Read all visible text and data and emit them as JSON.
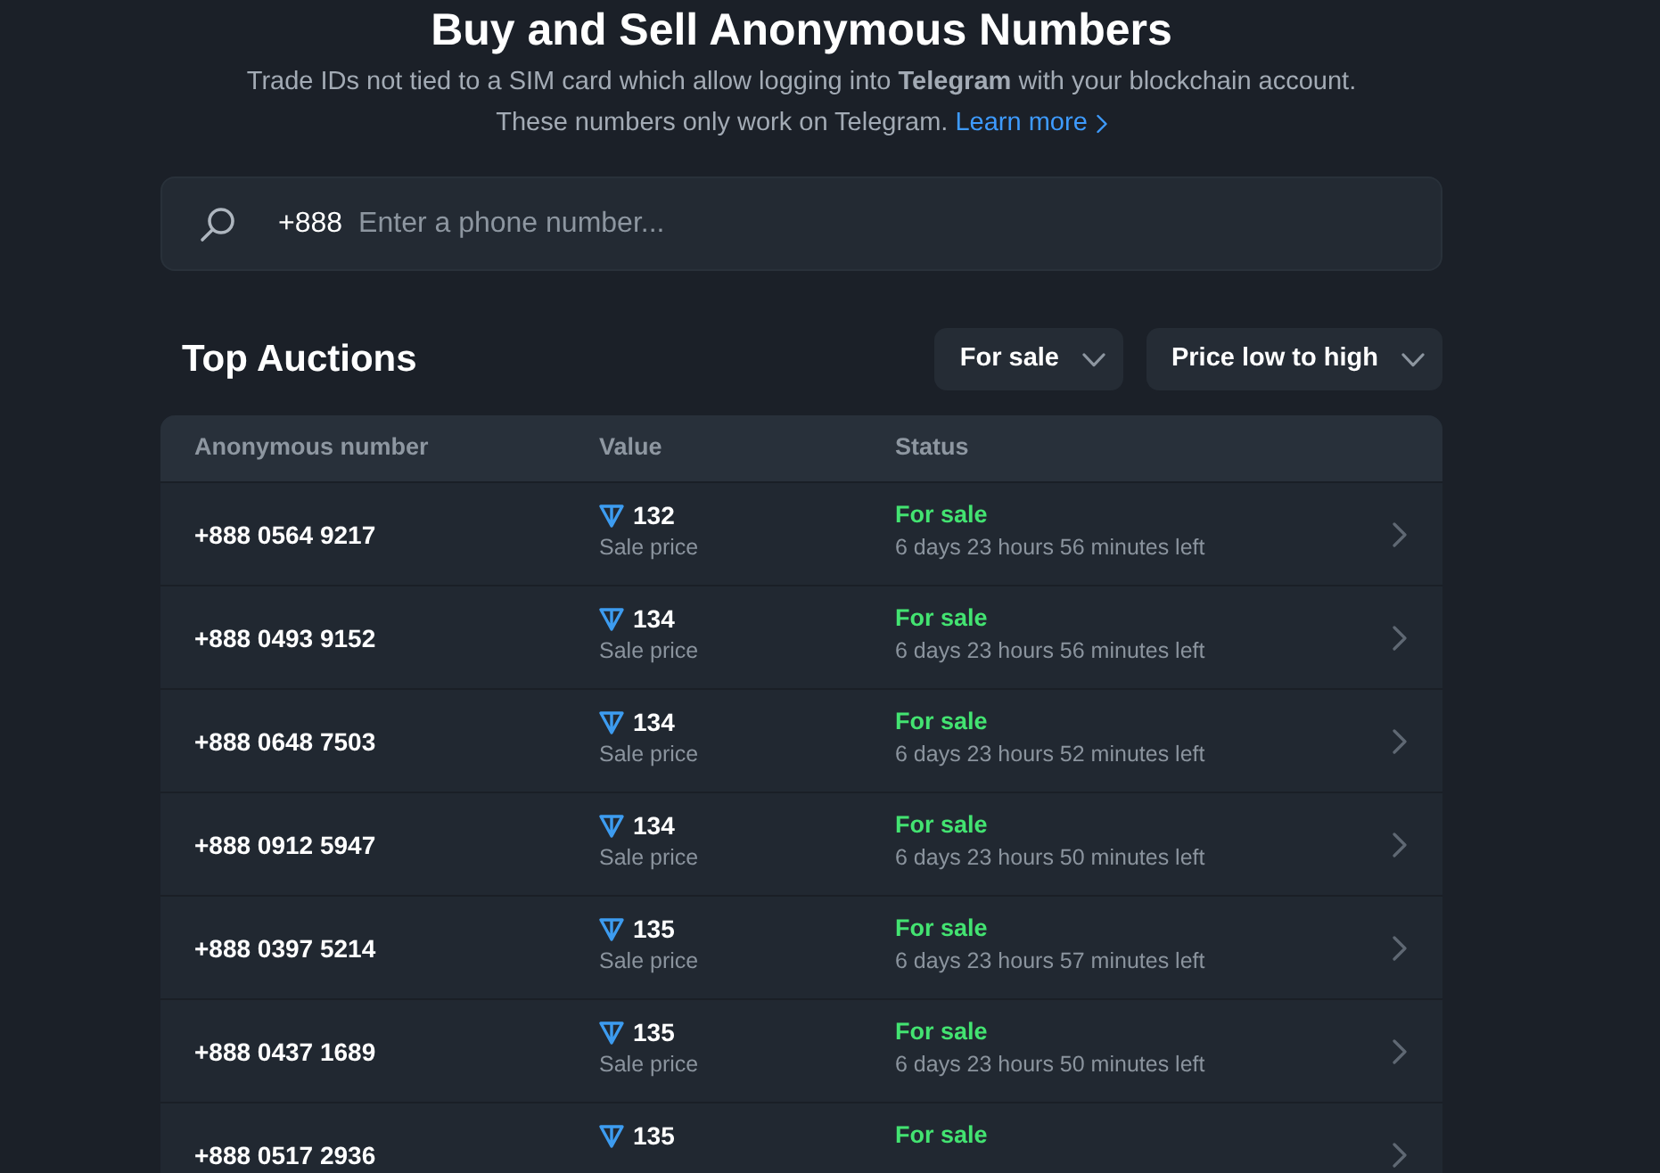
{
  "page": {
    "title": "Buy and Sell Anonymous Numbers",
    "description": "Trade IDs not tied to a SIM card which allow logging into **Telegram** with your blockchain account.",
    "description_2": "These numbers only work on Telegram.",
    "learn_more": "Learn more"
  },
  "search": {
    "prefix": "+888",
    "placeholder": "Enter a phone number..."
  },
  "section": {
    "title": "Top Auctions",
    "filters": [
      {
        "label": "For sale"
      },
      {
        "label": "Price low to high"
      }
    ]
  },
  "table": {
    "columns": [
      "Anonymous number",
      "Value",
      "Status"
    ],
    "rows": [
      {
        "number": "+888 0564 9217",
        "value": "132",
        "value_label": "Sale price",
        "status": "For sale",
        "time_left": "6 days 23 hours 56 minutes left"
      },
      {
        "number": "+888 0493 9152",
        "value": "134",
        "value_label": "Sale price",
        "status": "For sale",
        "time_left": "6 days 23 hours 56 minutes left"
      },
      {
        "number": "+888 0648 7503",
        "value": "134",
        "value_label": "Sale price",
        "status": "For sale",
        "time_left": "6 days 23 hours 52 minutes left"
      },
      {
        "number": "+888 0912 5947",
        "value": "134",
        "value_label": "Sale price",
        "status": "For sale",
        "time_left": "6 days 23 hours 50 minutes left"
      },
      {
        "number": "+888 0397 5214",
        "value": "135",
        "value_label": "Sale price",
        "status": "For sale",
        "time_left": "6 days 23 hours 57 minutes left"
      },
      {
        "number": "+888 0437 1689",
        "value": "135",
        "value_label": "Sale price",
        "status": "For sale",
        "time_left": "6 days 23 hours 50 minutes left"
      },
      {
        "number": "+888 0517 2936",
        "value": "135",
        "status": "For sale"
      }
    ]
  }
}
